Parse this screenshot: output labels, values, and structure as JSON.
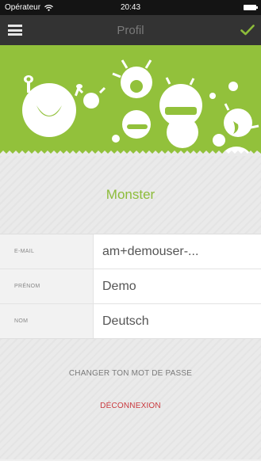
{
  "status_bar": {
    "carrier": "Opérateur",
    "time": "20:43"
  },
  "navbar": {
    "title": "Profil",
    "menu_icon": "hamburger-menu-icon",
    "confirm_icon": "checkmark-icon"
  },
  "banner": {
    "illustration": "monsters-illustration",
    "background": "#92c13b"
  },
  "profile": {
    "username": "Monster"
  },
  "form": {
    "fields": [
      {
        "label": "E-MAIL",
        "value": "am+demouser-..."
      },
      {
        "label": "PRÉNOM",
        "value": "Demo"
      },
      {
        "label": "NOM",
        "value": "Deutsch"
      }
    ]
  },
  "actions": {
    "change_password": "CHANGER TON MOT DE PASSE",
    "logout": "DÉCONNEXION"
  },
  "colors": {
    "accent_green": "#8dbc3a",
    "logout_red": "#c9383d",
    "nav_background": "#333333"
  }
}
